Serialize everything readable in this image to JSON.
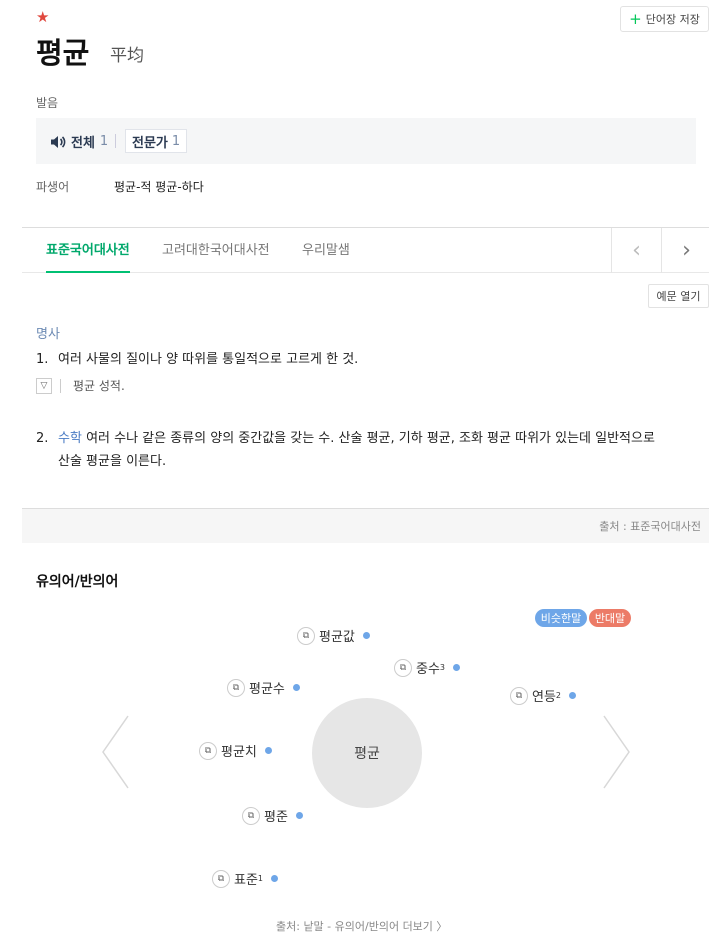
{
  "header": {
    "star_icon": "star-icon",
    "save_button_label": "단어장 저장",
    "word": "평균",
    "hanja": "平均"
  },
  "pronunciation": {
    "label": "발음",
    "all_label": "전체",
    "all_count": "1",
    "expert_label": "전문가",
    "expert_count": "1"
  },
  "derivative": {
    "label": "파생어",
    "value": "평균-적 평균-하다"
  },
  "tabs": [
    {
      "label": "표준국어대사전",
      "active": true
    },
    {
      "label": "고려대한국어대사전",
      "active": false
    },
    {
      "label": "우리말샘",
      "active": false
    }
  ],
  "example_button_label": "예문 열기",
  "part_of_speech": "명사",
  "definitions": [
    {
      "num": "1.",
      "field": "",
      "text": "여러 사물의 질이나 양 따위를 통일적으로 고르게 한 것.",
      "example": "평균 성적."
    },
    {
      "num": "2.",
      "field": "수학",
      "text_line1": "여러 수나 같은 종류의 양의 중간값을 갖는 수. 산술 평균, 기하 평균, 조화 평균 따위가 있는데 일반적으로",
      "text_line2": "산술 평균을 이른다."
    }
  ],
  "source_text": "출처 : 표준국어대사전",
  "synonyms": {
    "title": "유의어/반의어",
    "badge_syn": "비슷한말",
    "badge_ant": "반대말",
    "center_word": "평균",
    "nodes": [
      {
        "word": "평균값",
        "sup": ""
      },
      {
        "word": "중수",
        "sup": "3"
      },
      {
        "word": "평균수",
        "sup": ""
      },
      {
        "word": "연등",
        "sup": "2"
      },
      {
        "word": "평균치",
        "sup": ""
      },
      {
        "word": "평준",
        "sup": ""
      },
      {
        "word": "표준",
        "sup": "1"
      }
    ],
    "colors": {
      "synonym": "#6ea6e8",
      "antonym": "#ec7b67"
    },
    "footer": "출처: 낱말 - 유의어/반의어 더보기 〉"
  }
}
